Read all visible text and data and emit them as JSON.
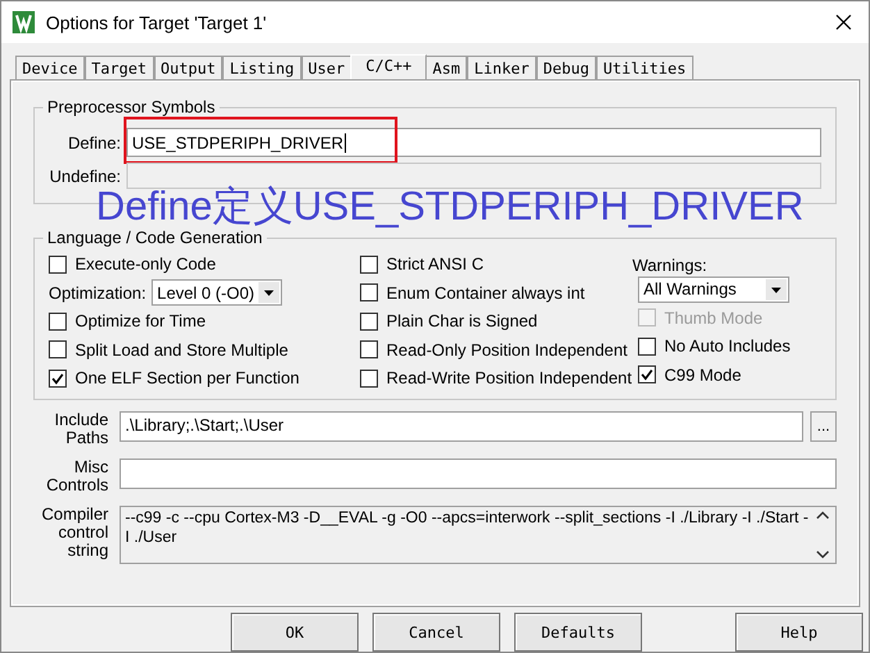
{
  "window": {
    "title": "Options for Target 'Target 1'"
  },
  "tabs": [
    {
      "label": "Device",
      "selected": false
    },
    {
      "label": "Target",
      "selected": false
    },
    {
      "label": "Output",
      "selected": false
    },
    {
      "label": "Listing",
      "selected": false
    },
    {
      "label": "User",
      "selected": false
    },
    {
      "label": "C/C++",
      "selected": true
    },
    {
      "label": "Asm",
      "selected": false
    },
    {
      "label": "Linker",
      "selected": false
    },
    {
      "label": "Debug",
      "selected": false
    },
    {
      "label": "Utilities",
      "selected": false
    }
  ],
  "preprocessor": {
    "title": "Preprocessor Symbols",
    "define": {
      "label": "Define:",
      "value": "USE_STDPERIPH_DRIVER",
      "highlighted": true
    },
    "undefine": {
      "label": "Undefine:"
    }
  },
  "annotation": {
    "text": "Define定义USE_STDPERIPH_DRIVER"
  },
  "language": {
    "title": "Language / Code Generation",
    "columns": [
      [
        {
          "kind": "checkbox",
          "label": "Execute-only Code",
          "checked": false,
          "disabled": false
        },
        {
          "kind": "select",
          "label": "Optimization:",
          "value": "Level 0 (-O0)"
        },
        {
          "kind": "checkbox",
          "label": "Optimize for Time",
          "checked": false,
          "disabled": false
        },
        {
          "kind": "checkbox",
          "label": "Split Load and Store Multiple",
          "checked": false,
          "disabled": false
        },
        {
          "kind": "checkbox",
          "label": "One ELF Section per Function",
          "checked": true,
          "disabled": false
        }
      ],
      [
        {
          "kind": "checkbox",
          "label": "Strict ANSI C",
          "checked": false,
          "disabled": false
        },
        {
          "kind": "checkbox",
          "label": "Enum Container always int",
          "checked": false,
          "disabled": false
        },
        {
          "kind": "checkbox",
          "label": "Plain Char is Signed",
          "checked": false,
          "disabled": false
        },
        {
          "kind": "checkbox",
          "label": "Read-Only Position Independent",
          "checked": false,
          "disabled": false
        },
        {
          "kind": "checkbox",
          "label": "Read-Write Position Independent",
          "checked": false,
          "disabled": false
        }
      ],
      [
        {
          "kind": "heading",
          "label": "Warnings:"
        },
        {
          "kind": "select",
          "value": "All Warnings"
        },
        {
          "kind": "checkbox",
          "label": "Thumb Mode",
          "checked": false,
          "disabled": true
        },
        {
          "kind": "checkbox",
          "label": "No Auto Includes",
          "checked": false,
          "disabled": false
        },
        {
          "kind": "checkbox",
          "label": "C99 Mode",
          "checked": true,
          "disabled": false
        }
      ]
    ]
  },
  "fields": [
    {
      "kind": "browse",
      "label": "Include Paths",
      "value": ".\\Library;.\\Start;.\\User",
      "button": "..."
    },
    {
      "kind": "field",
      "label": "Misc Controls"
    },
    {
      "kind": "multiline",
      "label": "Compiler control string",
      "value": "--c99 -c --cpu Cortex-M3 -D__EVAL -g -O0 --apcs=interwork --split_sections -I ./Library -I ./Start -I ./User"
    }
  ],
  "buttons": [
    {
      "label": "OK"
    },
    {
      "label": "Cancel"
    },
    {
      "label": "Defaults"
    },
    {
      "label": "Help"
    }
  ]
}
